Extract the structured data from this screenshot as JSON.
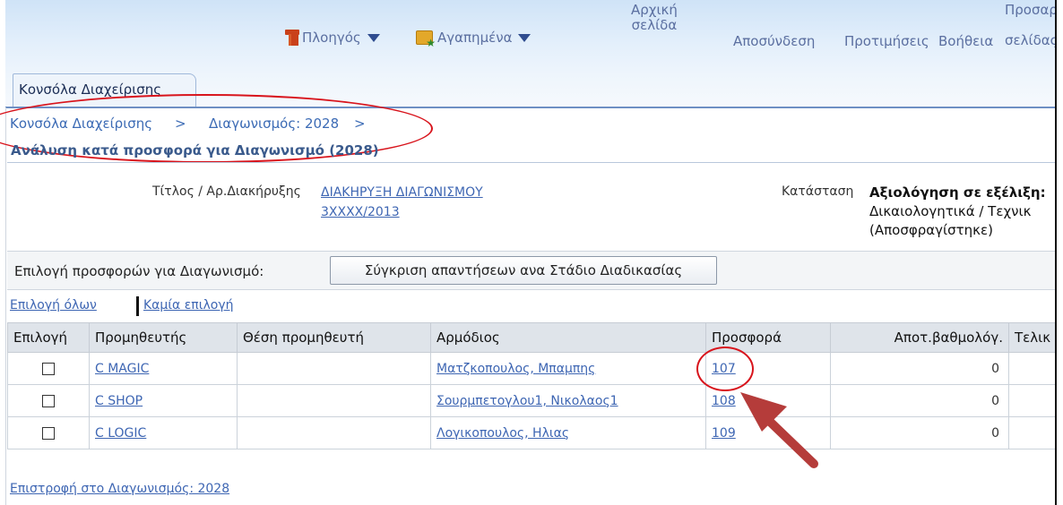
{
  "header": {
    "navigator_label": "Πλοηγός",
    "favorites_label": "Αγαπημένα",
    "home_line1": "Αρχική",
    "home_line2": "σελίδα",
    "logout_label": "Αποσύνδεση",
    "preferences_label": "Προτιμήσεις",
    "help_label": "Βοήθεια",
    "personalize_line1": "Προσαρ",
    "personalize_line2": "σελίδας",
    "active_tab": "Κονσόλα Διαχείρισης"
  },
  "breadcrumb": {
    "item1": "Κονσόλα Διαχείρισης",
    "sep1": ">",
    "item2": "Διαγωνισμός: 2028",
    "sep2": ">"
  },
  "page_title": "Ανάλυση κατά προσφορά για Διαγωνισμό (2028)",
  "details": {
    "title_label": "Τίτλος / Αρ.Διακήρυξης",
    "title_value_line1": "ΔΙΑΚΗΡΥΞΗ ΔΙΑΓΩΝΙΣΜΟΥ",
    "title_value_line2": "3ΧΧΧΧ/2013",
    "status_label": "Κατάσταση",
    "status_line1": "Αξιολόγηση σε εξέλιξη:",
    "status_line2": "Δικαιολογητικά / Τεχνικ",
    "status_line3": "(Αποσφραγίστηκε)"
  },
  "selection": {
    "label": "Επιλογή προσφορών για Διαγωνισμό:",
    "compare_button": "Σύγκριση απαντήσεων ανα Στάδιο Διαδικασίας",
    "select_all": "Επιλογή όλων",
    "select_none": "Καμία επιλογή"
  },
  "table": {
    "headers": [
      "Επιλογή",
      "Προμηθευτής",
      "Θέση προμηθευτή",
      "Αρμόδιος",
      "Προσφορά",
      "Αποτ.βαθμολόγ.",
      "Τελικ"
    ],
    "rows": [
      {
        "supplier": "C MAGIC",
        "site": "",
        "contact": "Ματζκοπουλος, Μπαμπης",
        "offer": "107",
        "score": "0"
      },
      {
        "supplier": "C SHOP",
        "site": "",
        "contact": "Σουρμπετογλου1, Νικολαος1",
        "offer": "108",
        "score": "0"
      },
      {
        "supplier": "C LOGIC",
        "site": "",
        "contact": "Λογικοπουλος, Ηλιας",
        "offer": "109",
        "score": "0"
      }
    ]
  },
  "back_link": "Επιστροφή στο Διαγωνισμός: 2028",
  "colors": {
    "link": "#3e66b3",
    "annotation_red": "#d8141c",
    "table_header_bg": "#dfe4ea"
  }
}
